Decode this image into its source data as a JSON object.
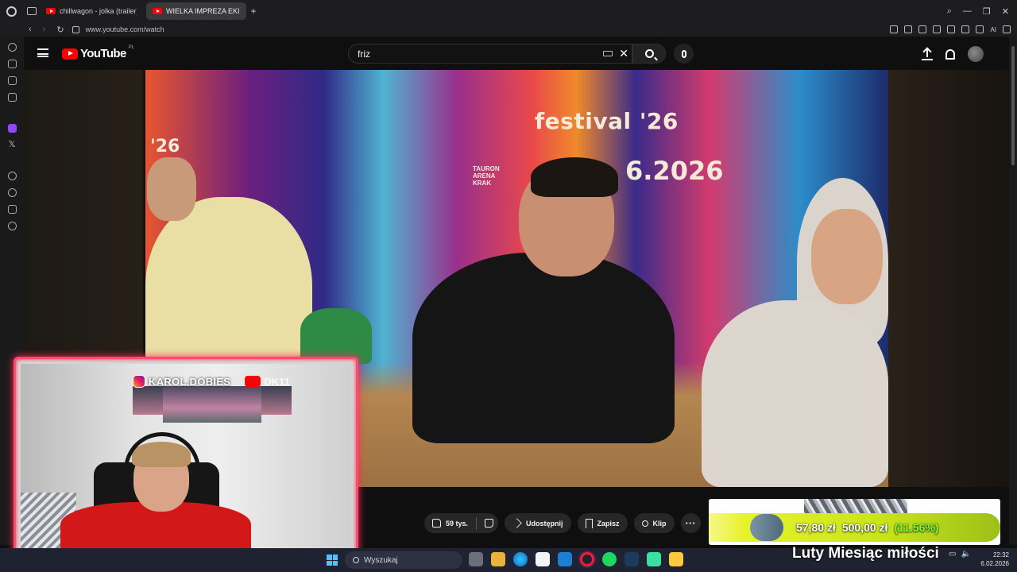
{
  "browser": {
    "tabs": [
      {
        "title": "chillwagon - jolka (trailer)",
        "active": false
      },
      {
        "title": "WIELKA IMPREZA EKI",
        "active": true
      }
    ],
    "new_tab": "+",
    "url": "www.youtube.com/watch",
    "ai_label": "AI"
  },
  "youtube": {
    "logo": "YouTube",
    "region": "PL",
    "search_value": "friz"
  },
  "video": {
    "banner_title": "festival '26",
    "banner_date": "6.2026",
    "arena_lines": "TAURON ARENA KRAK",
    "banner_year_left": "'26"
  },
  "actions": {
    "likes": "59 tys.",
    "share": "Udostępnij",
    "save": "Zapisz",
    "clip": "Klip",
    "more": "···"
  },
  "webcam": {
    "instagram_handle": "KAROL.DOBIES",
    "youtube_handle": "DK11"
  },
  "goal": {
    "current": "57,80 zł",
    "target": "500,00 zł",
    "percent": "(11.56%)",
    "progress_fraction": 0.1156
  },
  "taskbar": {
    "search_placeholder": "Wyszukaj",
    "ticker": "Luty Miesiąc miłości",
    "time": "22:32",
    "date": "6.02.2026"
  },
  "colors": {
    "overlay_border": "#ff4b6e",
    "goal_bar": "#c7e41a",
    "goal_percent": "#7dff3a",
    "youtube_red": "#ff0000"
  }
}
